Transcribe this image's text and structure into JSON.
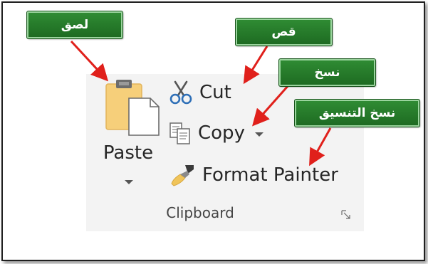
{
  "ribbon": {
    "group_label": "Clipboard",
    "paste_label": "Paste",
    "cut_label": "Cut",
    "copy_label": "Copy",
    "format_painter_label": "Format Painter",
    "icons": {
      "paste": "clipboard-paste-icon",
      "cut": "scissors-icon",
      "copy": "copy-icon",
      "format_painter": "paintbrush-icon",
      "launcher": "dialog-launcher-icon"
    }
  },
  "callouts": {
    "paste": "لصق",
    "cut": "قص",
    "copy": "نسخ",
    "format_painter": "نسخ التنسيق"
  },
  "colors": {
    "callout_green": "#257a29",
    "arrow_red": "#e0201b",
    "ribbon_bg": "#f3f3f3"
  }
}
